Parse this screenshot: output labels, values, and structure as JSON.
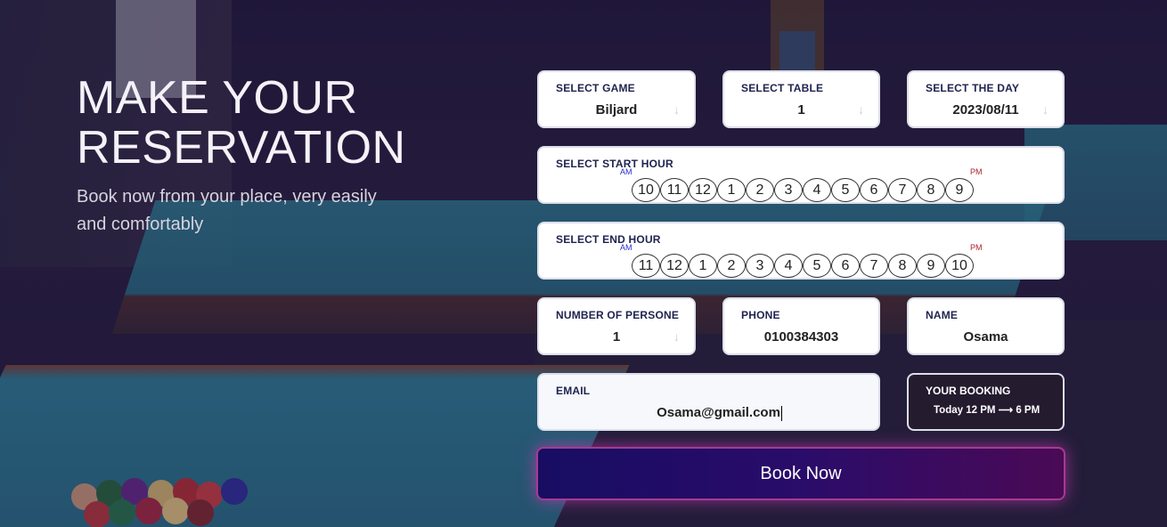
{
  "hero": {
    "title": "MAKE YOUR RESERVATION",
    "subtitle": "Book now from your place, very easily and comfortably"
  },
  "form": {
    "game": {
      "label": "SELECT GAME",
      "value": "Biljard"
    },
    "table": {
      "label": "SELECT TABLE",
      "value": "1"
    },
    "day": {
      "label": "SELECT THE DAY",
      "value": "2023/08/11"
    },
    "start_hour": {
      "label": "SELECT START HOUR",
      "am_label": "AM",
      "pm_label": "PM",
      "hours": [
        "10",
        "11",
        "12",
        "1",
        "2",
        "3",
        "4",
        "5",
        "6",
        "7",
        "8",
        "9"
      ]
    },
    "end_hour": {
      "label": "SELECT END HOUR",
      "am_label": "AM",
      "pm_label": "PM",
      "hours": [
        "11",
        "12",
        "1",
        "2",
        "3",
        "4",
        "5",
        "6",
        "7",
        "8",
        "9",
        "10"
      ]
    },
    "persons": {
      "label": "NUMBER OF PERSONE",
      "value": "1"
    },
    "phone": {
      "label": "PHONE",
      "value": "0100384303"
    },
    "name": {
      "label": "NAME",
      "value": "Osama"
    },
    "email": {
      "label": "EMAIL",
      "value": "Osama@gmail.com"
    },
    "booking": {
      "label": "YOUR BOOKING",
      "summary": "Today 12 PM ⟶ 6 PM"
    },
    "submit_label": "Book Now",
    "dropdown_arrow": "↓"
  },
  "colors": {
    "button_start": "#170d63",
    "button_end": "#4a0a55",
    "glow": "#d23cbe",
    "am": "#2b2bd0",
    "pm": "#b0202a"
  }
}
